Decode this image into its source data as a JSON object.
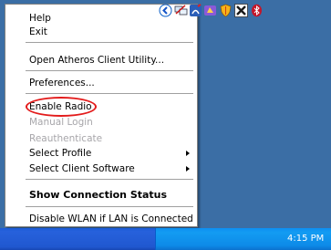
{
  "menu": {
    "help": "Help",
    "exit": "Exit",
    "open_utility": "Open Atheros Client Utility...",
    "preferences": "Preferences...",
    "enable_radio": "Enable Radio",
    "manual_login": "Manual Login",
    "reauthenticate": "Reauthenticate",
    "select_profile": "Select Profile",
    "select_client_software": "Select Client Software",
    "show_connection_status": "Show Connection Status",
    "disable_wlan": "Disable WLAN if LAN is Connected"
  },
  "taskbar": {
    "clock": "4:15 PM",
    "tray_icons": [
      "chevron-left-icon",
      "network-icon",
      "wireless-icon",
      "app-icon",
      "shield-icon",
      "red-x-icon",
      "bluetooth-icon"
    ]
  },
  "colors": {
    "desktop": "#3b6ea5",
    "highlight_circle": "#e31b1b",
    "disabled_text": "#a7a6aa"
  }
}
